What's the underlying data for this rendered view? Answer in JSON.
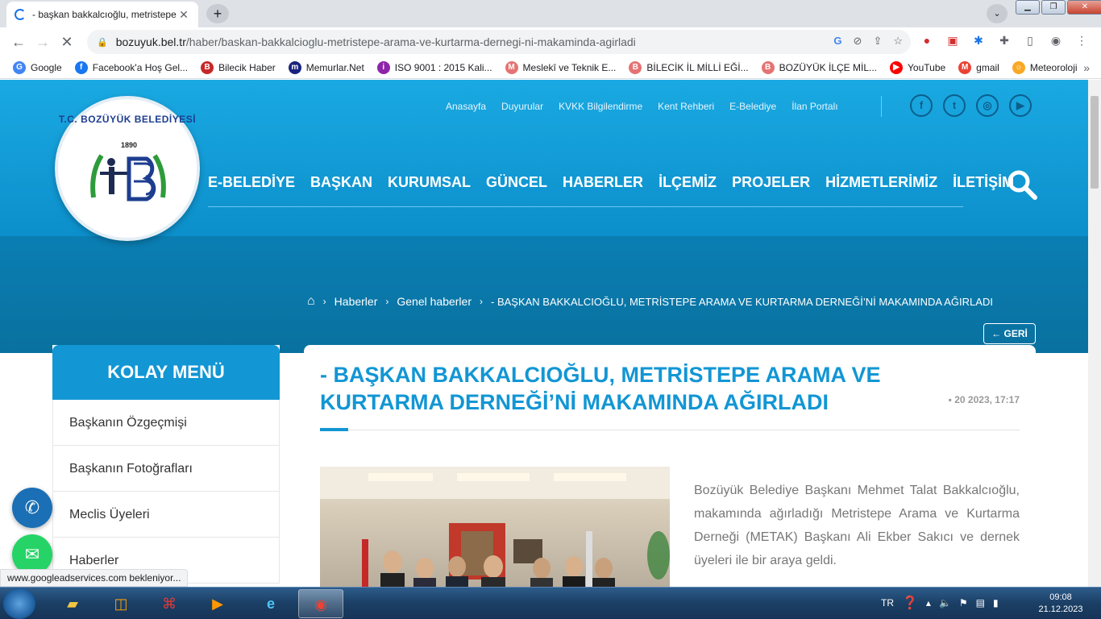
{
  "browser": {
    "tab_title": "- başkan bakkalcıoğlu, metristepe",
    "url_host": "bozuyuk.bel.tr",
    "url_path": "/haber/baskan-bakkalcioglu-metristepe-arama-ve-kurtarma-dernegi-ni-makaminda-agirladi",
    "bookmarks": [
      {
        "label": "Google",
        "color": "#4285f4",
        "glyph": "G"
      },
      {
        "label": "Facebook'a Hoş Gel...",
        "color": "#1877f2",
        "glyph": "f"
      },
      {
        "label": "Bilecik Haber",
        "color": "#c62828",
        "glyph": "B"
      },
      {
        "label": "Memurlar.Net",
        "color": "#1a237e",
        "glyph": "m"
      },
      {
        "label": "ISO 9001 : 2015 Kali...",
        "color": "#8e24aa",
        "glyph": "i"
      },
      {
        "label": "Meslekî ve Teknik E...",
        "color": "#e57373",
        "glyph": "M"
      },
      {
        "label": "BİLECİK İL MİLLİ EĞİ...",
        "color": "#e57373",
        "glyph": "B"
      },
      {
        "label": "BOZÜYÜK İLÇE MİL...",
        "color": "#e57373",
        "glyph": "B"
      },
      {
        "label": "YouTube",
        "color": "#ff0000",
        "glyph": "▶"
      },
      {
        "label": "gmail",
        "color": "#ea4335",
        "glyph": "M"
      },
      {
        "label": "Meteoroloji",
        "color": "#f9a825",
        "glyph": "☼"
      }
    ],
    "status_text": "www.googleadservices.com bekleniyor..."
  },
  "site": {
    "logo_text": "T.C. BOZÜYÜK BELEDİYESİ",
    "logo_year": "1890",
    "top_nav": [
      "Anasayfa",
      "Duyurular",
      "KVKK Bilgilendirme",
      "Kent Rehberi",
      "E-Belediye",
      "İlan Portalı"
    ],
    "social": [
      "f",
      "t",
      "◎",
      "▶"
    ],
    "main_nav": [
      "E-BELEDİYE",
      "BAŞKAN",
      "KURUMSAL",
      "GÜNCEL",
      "HABERLER",
      "İLÇEMİZ",
      "PROJELER",
      "HİZMETLERİMİZ",
      "İLETİŞİM"
    ],
    "breadcrumb": [
      "Haberler",
      "Genel haberler",
      "- BAŞKAN BAKKALCIOĞLU, METRİSTEPE ARAMA VE KURTARMA DERNEĞİ’Nİ MAKAMINDA AĞIRLADI"
    ],
    "back_label": "GERİ",
    "sidebar": {
      "title": "KOLAY MENÜ",
      "items": [
        "Başkanın Özgeçmişi",
        "Başkanın Fotoğrafları",
        "Meclis Üyeleri",
        "Haberler"
      ]
    },
    "article": {
      "title": "- BAŞKAN BAKKALCIOĞLU, METRİSTEPE ARAMA VE KURTARMA DERNEĞİ’Nİ MAKAMINDA AĞIRLADI",
      "date": "20 2023, 17:17",
      "body": "Bozüyük Belediye Başkanı Mehmet Talat Bakkalcıoğlu, makamında ağırladığı Metristepe Arama ve Kurtarma Derneği (METAK) Başkanı Ali Ekber Sakıcı ve dernek üyeleri ile bir araya geldi."
    }
  },
  "taskbar": {
    "lang": "TR",
    "time": "09:08",
    "date": "21.12.2023"
  },
  "colors": {
    "brand_blue": "#1296d4",
    "hero_dark": "#0a7fb4"
  }
}
